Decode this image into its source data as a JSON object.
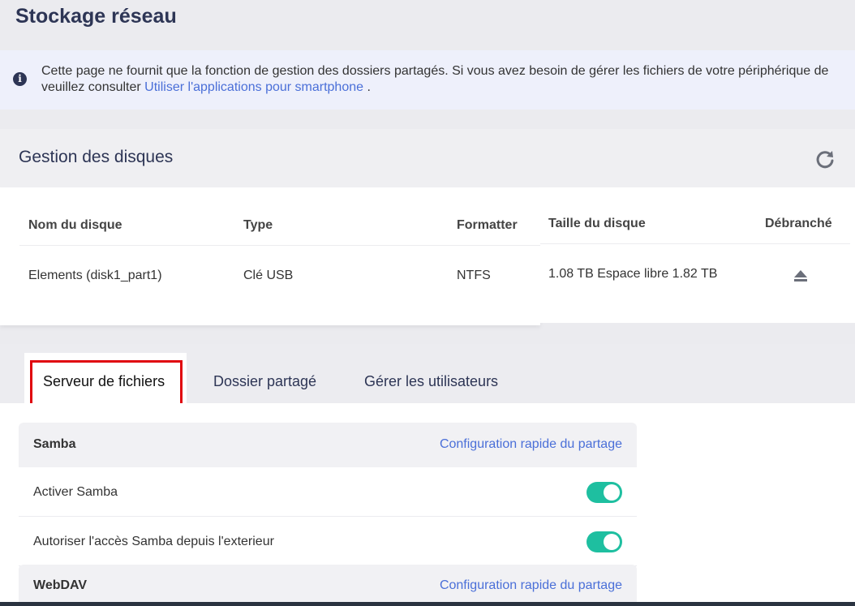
{
  "page": {
    "title": "Stockage réseau"
  },
  "notice": {
    "text_part1": "Cette page ne fournit que la fonction de gestion des dossiers partagés. Si vous avez besoin de gérer les fichiers de votre périphérique de",
    "text_part2": "veuillez consulter ",
    "link": "Utiliser l'applications pour smartphone",
    "text_part3": " .",
    "icon": "info-icon"
  },
  "disks": {
    "title": "Gestion des disques",
    "refresh_icon": "refresh-icon",
    "columns": [
      "Nom du disque",
      "Type",
      "Formatter",
      "Taille du disque",
      "Débranché"
    ],
    "rows": [
      {
        "name": "Elements (disk1_part1)",
        "type": "Clé USB",
        "format": "NTFS",
        "size": "1.08 TB Espace libre 1.82 TB",
        "eject_icon": "eject-icon"
      }
    ]
  },
  "tabs": [
    {
      "label": "Serveur de fichiers",
      "active": true
    },
    {
      "label": "Dossier partagé",
      "active": false
    },
    {
      "label": "Gérer les utilisateurs",
      "active": false
    }
  ],
  "samba": {
    "title": "Samba",
    "quick_link": "Configuration rapide du partage",
    "settings": [
      {
        "label": "Activer Samba",
        "enabled": true
      },
      {
        "label": "Autoriser l'accès Samba depuis l'exterieur",
        "enabled": true
      }
    ]
  },
  "webdav": {
    "title": "WebDAV",
    "quick_link": "Configuration rapide du partage"
  },
  "colors": {
    "accent": "#4a6fd8",
    "toggle_on": "#1ebfa0",
    "title": "#2d3555",
    "highlight": "#e0060f"
  }
}
